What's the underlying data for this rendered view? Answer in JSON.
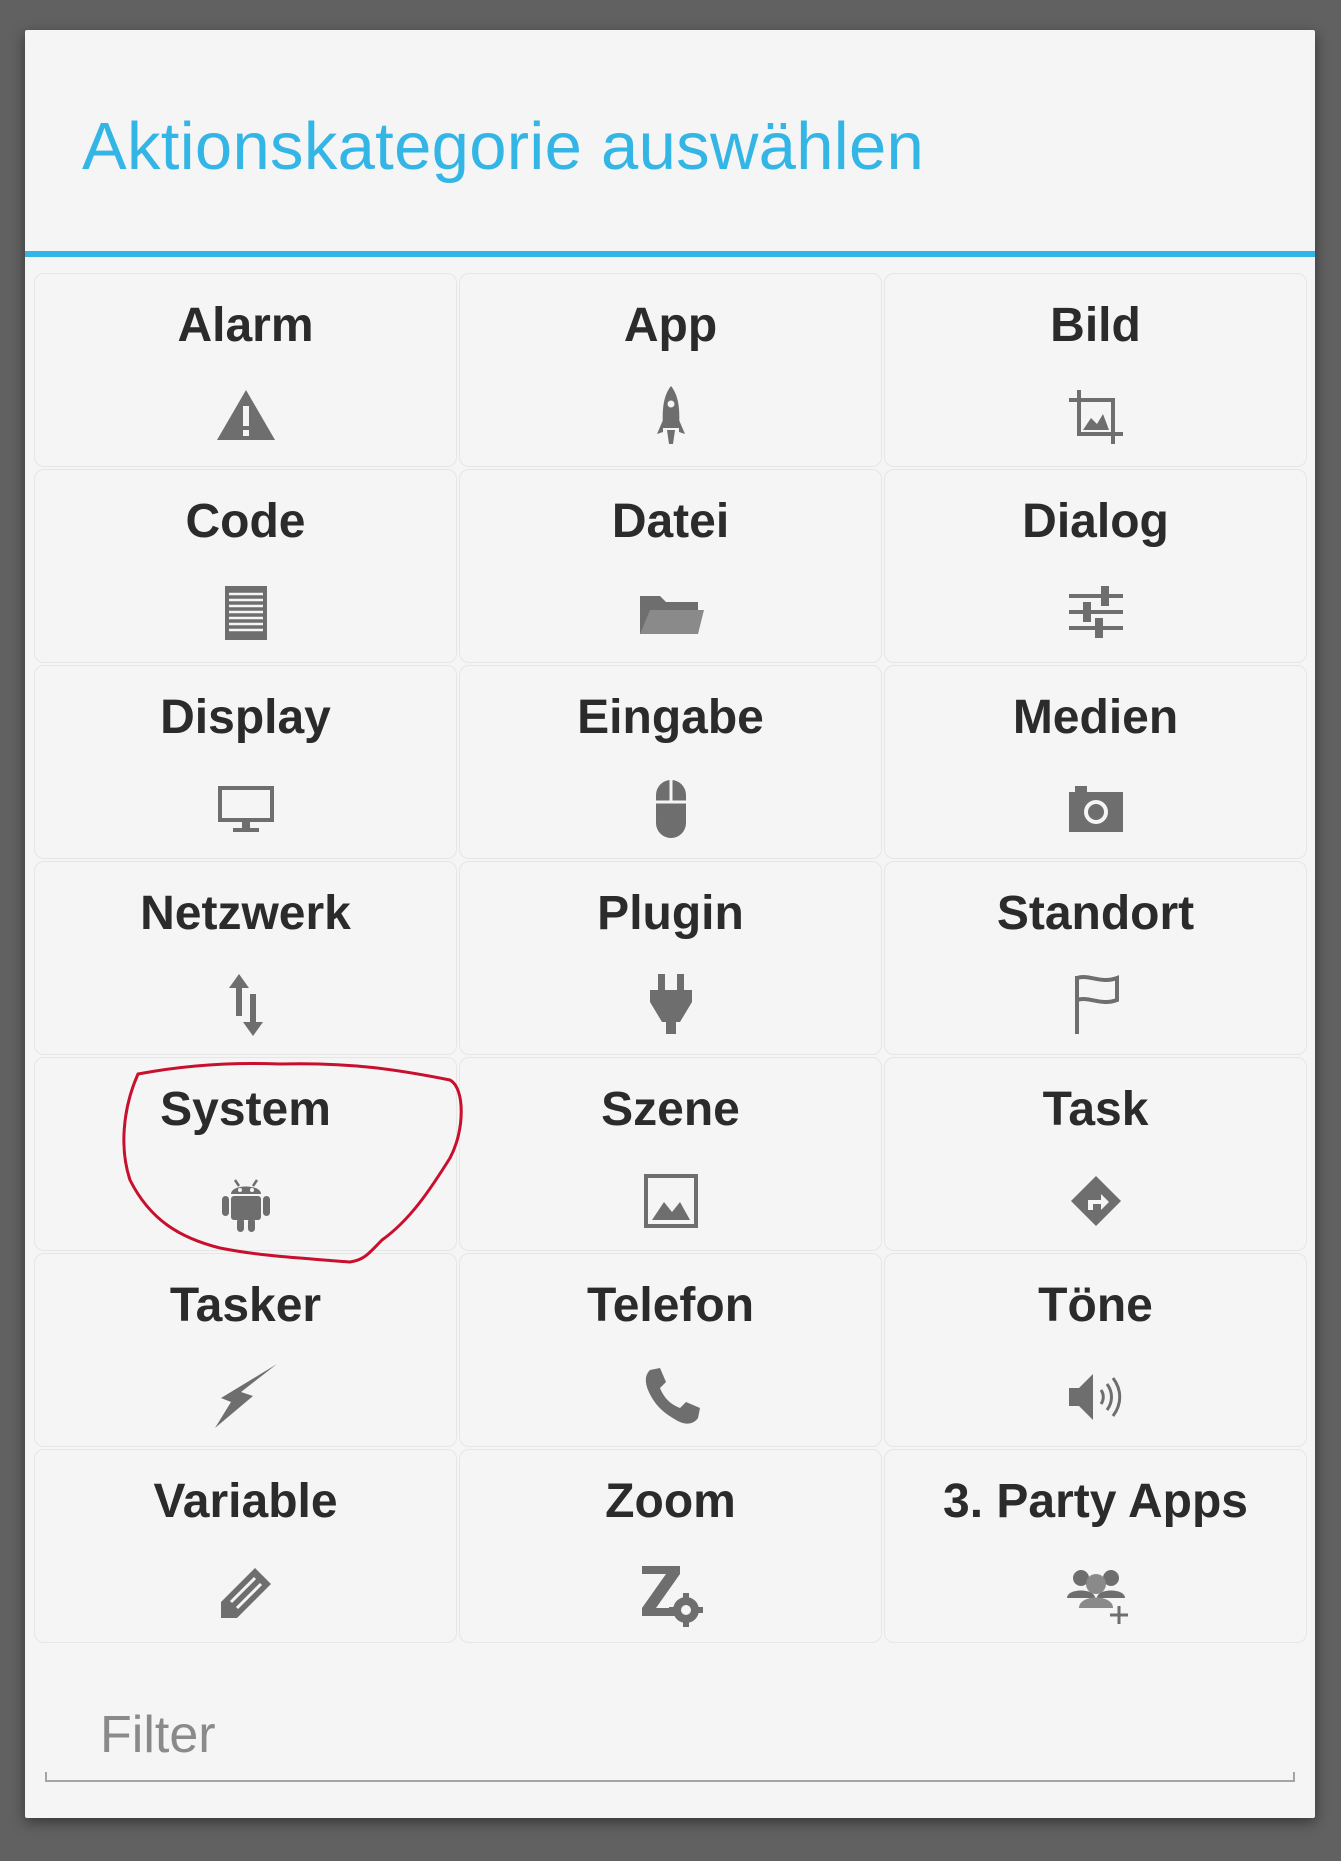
{
  "dialog": {
    "title": "Aktionskategorie auswählen",
    "accent_color": "#33b5e5",
    "categories": [
      {
        "label": "Alarm",
        "icon": "warning-icon"
      },
      {
        "label": "App",
        "icon": "rocket-icon"
      },
      {
        "label": "Bild",
        "icon": "crop-image-icon"
      },
      {
        "label": "Code",
        "icon": "document-lines-icon"
      },
      {
        "label": "Datei",
        "icon": "folder-open-icon"
      },
      {
        "label": "Dialog",
        "icon": "sliders-icon"
      },
      {
        "label": "Display",
        "icon": "monitor-icon"
      },
      {
        "label": "Eingabe",
        "icon": "mouse-icon"
      },
      {
        "label": "Medien",
        "icon": "camera-icon"
      },
      {
        "label": "Netzwerk",
        "icon": "up-down-arrows-icon"
      },
      {
        "label": "Plugin",
        "icon": "plug-icon"
      },
      {
        "label": "Standort",
        "icon": "flag-icon"
      },
      {
        "label": "System",
        "icon": "android-icon"
      },
      {
        "label": "Szene",
        "icon": "picture-icon"
      },
      {
        "label": "Task",
        "icon": "turn-sign-icon"
      },
      {
        "label": "Tasker",
        "icon": "lightning-icon"
      },
      {
        "label": "Telefon",
        "icon": "phone-icon"
      },
      {
        "label": "Töne",
        "icon": "speaker-icon"
      },
      {
        "label": "Variable",
        "icon": "pencil-icon"
      },
      {
        "label": "Zoom",
        "icon": "zoom-gear-icon"
      },
      {
        "label": "3. Party Apps",
        "icon": "group-add-icon"
      }
    ],
    "filter": {
      "placeholder": "Filter",
      "value": ""
    },
    "annotation_color": "#c8102e"
  }
}
